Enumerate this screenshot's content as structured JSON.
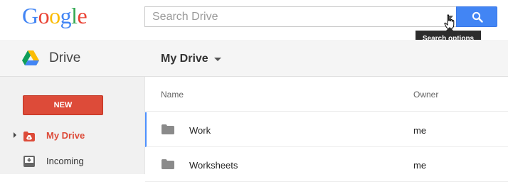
{
  "header": {
    "logo_letters": [
      {
        "char": "G",
        "color": "#4285f4"
      },
      {
        "char": "o",
        "color": "#ea4335"
      },
      {
        "char": "o",
        "color": "#fbbc05"
      },
      {
        "char": "g",
        "color": "#4285f4"
      },
      {
        "char": "l",
        "color": "#34a853"
      },
      {
        "char": "e",
        "color": "#ea4335"
      }
    ],
    "search": {
      "placeholder": "Search Drive",
      "value": "",
      "tooltip": "Search options"
    },
    "search_button_icon": "search-icon",
    "accent_color": "#4285f4"
  },
  "appbar": {
    "product_name": "Drive",
    "location_label": "My Drive"
  },
  "sidebar": {
    "new_button_label": "NEW",
    "new_button_color": "#dd4b39",
    "items": [
      {
        "label": "My Drive",
        "icon": "my-drive-icon",
        "active": true
      },
      {
        "label": "Incoming",
        "icon": "incoming-icon",
        "active": false
      }
    ]
  },
  "main": {
    "columns": {
      "name": "Name",
      "owner": "Owner"
    },
    "files": [
      {
        "name": "Work",
        "owner": "me",
        "icon": "folder-icon",
        "selected": true
      },
      {
        "name": "Worksheets",
        "owner": "me",
        "icon": "folder-icon",
        "selected": false
      }
    ]
  }
}
